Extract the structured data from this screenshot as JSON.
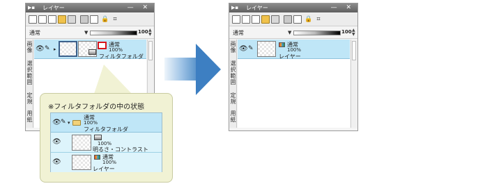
{
  "left_panel": {
    "title": "レイヤー",
    "blend_mode": "通常",
    "opacity": "100",
    "side_tabs": [
      "画像",
      "選択範囲",
      "定規",
      "用紙"
    ],
    "layer": {
      "mode": "通常",
      "opacity": "100%",
      "name": "フィルタフォルダ"
    }
  },
  "right_panel": {
    "title": "レイヤー",
    "blend_mode": "通常",
    "opacity": "100",
    "side_tabs": [
      "画像",
      "選択範囲",
      "定規",
      "用紙"
    ],
    "layer": {
      "mode": "通常",
      "opacity": "100%",
      "name": "レイヤー"
    }
  },
  "callout": {
    "title": "※フィルタフォルダの中の状態",
    "rows": [
      {
        "mode": "通常",
        "opacity": "100%",
        "name": "フィルタフォルダ"
      },
      {
        "mode": "",
        "opacity": "100%",
        "name": "明るさ・コントラスト"
      },
      {
        "mode": "通常",
        "opacity": "100%",
        "name": "レイヤー"
      }
    ]
  },
  "icons": {
    "visibility": "eye-icon",
    "edit": "pen-icon",
    "folder": "folder-icon",
    "filter": "palette-icon",
    "adjustment": "brightness-contrast-icon",
    "arrow": "right-arrow"
  },
  "colors": {
    "selected_row": "#bfe6f7",
    "title_bar": "#6f6f6f",
    "callout_bg": "#f1f2d4",
    "arrow": "#3d7fc2",
    "highlight_box": "#d8141b"
  }
}
